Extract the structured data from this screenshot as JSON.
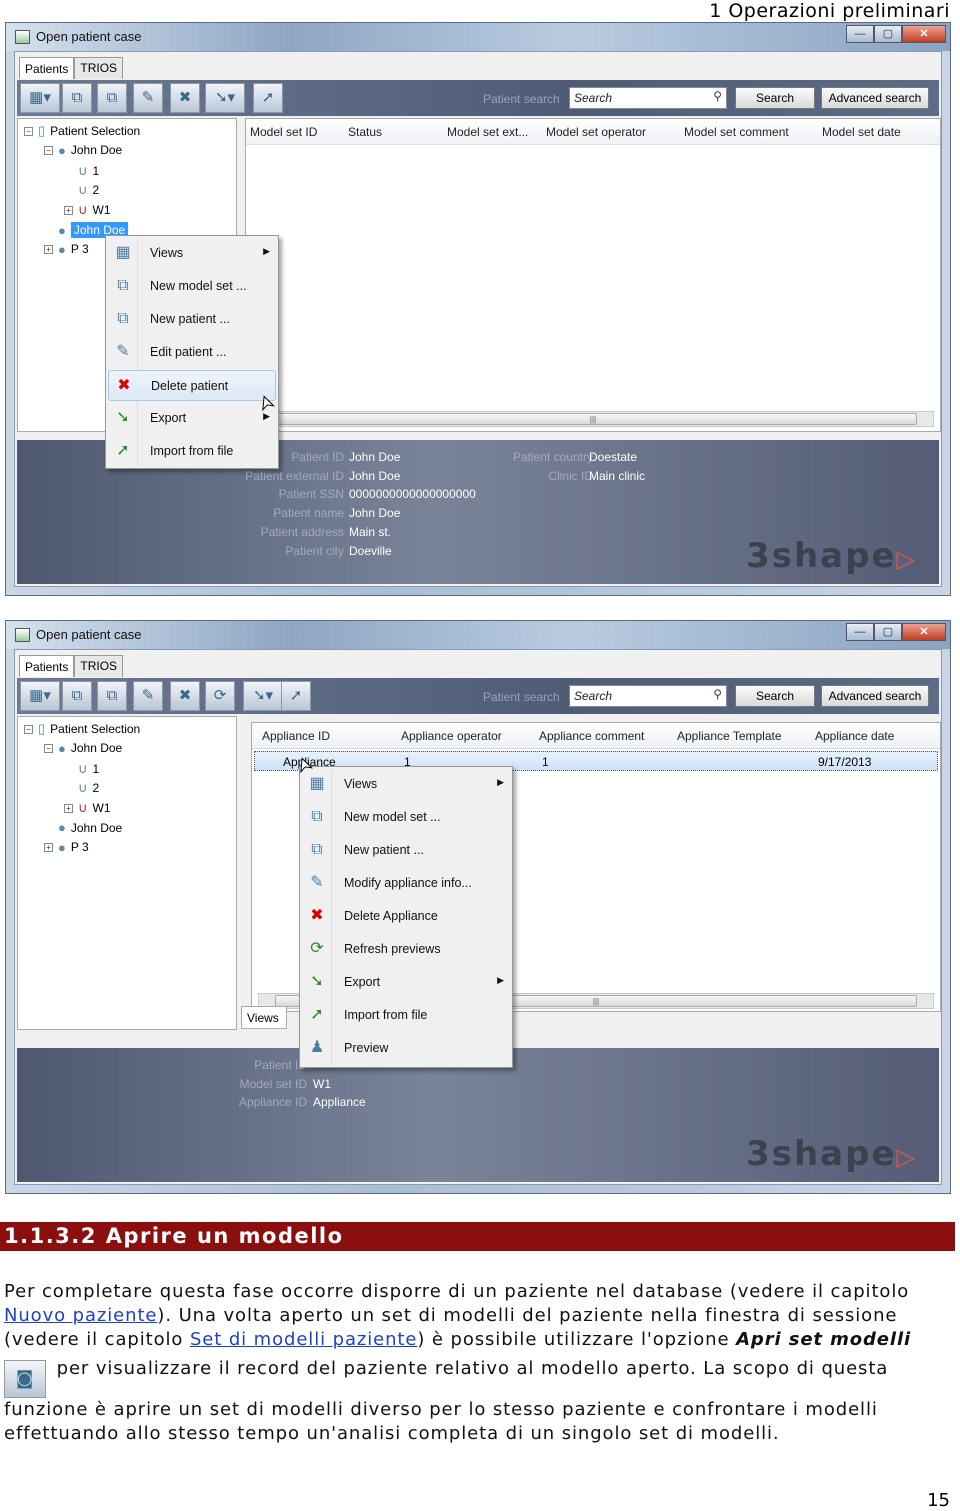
{
  "page_header": "1 Operazioni preliminari",
  "page_number": "15",
  "windows": [
    {
      "title": "Open patient case",
      "tabs": [
        "Patients",
        "TRIOS"
      ],
      "toolbar_icons": [
        "views-grid-icon",
        "new-model-set-icon",
        "new-patient-icon",
        "edit-patient-icon",
        "delete-patient-icon",
        "export-icon",
        "import-icon"
      ],
      "patient_search_label": "Patient search",
      "search_placeholder": "Search",
      "search_button": "Search",
      "advanced_search_button": "Advanced search",
      "tree": [
        {
          "label": "Patient Selection",
          "level": 0,
          "expander": "−",
          "icon": "folder-icon"
        },
        {
          "label": "John Doe",
          "level": 1,
          "expander": "−",
          "icon": "patient-icon"
        },
        {
          "label": "1",
          "level": 2,
          "icon": "appliance-icon"
        },
        {
          "label": "2",
          "level": 2,
          "icon": "appliance-icon"
        },
        {
          "label": "W1",
          "level": 2,
          "expander": "+",
          "icon": "appliance-alert-icon"
        },
        {
          "label": "John Doe",
          "level": 1,
          "icon": "patient-icon",
          "selected": true
        },
        {
          "label": "P 3",
          "level": 1,
          "expander": "+",
          "icon": "patient-icon"
        }
      ],
      "columns": [
        "Model set ID",
        "Status",
        "Model set ext...",
        "Model set operator",
        "Model set comment",
        "Model set date"
      ],
      "rows": [],
      "details_left": [
        [
          "Patient ID",
          "John Doe"
        ],
        [
          "Patient external ID",
          "John Doe"
        ],
        [
          "Patient SSN",
          "0000000000000000000"
        ],
        [
          "Patient name",
          "John Doe"
        ],
        [
          "Patient address",
          "Main st."
        ],
        [
          "Patient city",
          "Doeville"
        ]
      ],
      "details_right": [
        [
          "Patient country",
          "Doestate"
        ],
        [
          "Clinic ID",
          "Main clinic"
        ]
      ],
      "context_menu": [
        {
          "label": "Views",
          "icon": "views-grid-icon",
          "submenu": true
        },
        {
          "label": "New model set ...",
          "icon": "new-model-set-icon"
        },
        {
          "label": "New patient ...",
          "icon": "new-patient-icon"
        },
        {
          "label": "Edit patient ...",
          "icon": "edit-patient-icon"
        },
        {
          "label": "Delete patient",
          "icon": "delete-patient-icon",
          "highlighted": true
        },
        {
          "label": "Export",
          "icon": "export-icon",
          "submenu": true
        },
        {
          "label": "Import from file",
          "icon": "import-icon"
        }
      ],
      "logo": "3shape"
    },
    {
      "title": "Open patient case",
      "tabs": [
        "Patients",
        "TRIOS"
      ],
      "toolbar_icons": [
        "views-grid-icon",
        "new-model-set-icon",
        "new-patient-icon",
        "modify-appliance-icon",
        "delete-appliance-icon",
        "refresh-icon",
        "export-icon",
        "import-icon"
      ],
      "patient_search_label": "Patient search",
      "search_placeholder": "Search",
      "search_button": "Search",
      "advanced_search_button": "Advanced search",
      "tree": [
        {
          "label": "Patient Selection",
          "level": 0,
          "expander": "−",
          "icon": "folder-icon"
        },
        {
          "label": "John Doe",
          "level": 1,
          "expander": "−",
          "icon": "patient-icon"
        },
        {
          "label": "1",
          "level": 2,
          "icon": "appliance-icon"
        },
        {
          "label": "2",
          "level": 2,
          "icon": "appliance-icon"
        },
        {
          "label": "W1",
          "level": 2,
          "expander": "+",
          "icon": "appliance-alert-icon"
        },
        {
          "label": "John Doe",
          "level": 1,
          "icon": "patient-icon"
        },
        {
          "label": "P 3",
          "level": 1,
          "expander": "+",
          "icon": "patient-icon"
        }
      ],
      "columns": [
        "Appliance ID",
        "Appliance operator",
        "Appliance comment",
        "Appliance Template",
        "Appliance date"
      ],
      "rows": [
        [
          "Appliance",
          "1",
          "1",
          "",
          "9/17/2013"
        ]
      ],
      "views_tab": "Views",
      "details_left": [
        [
          "Patient ID",
          ""
        ],
        [
          "Model set ID",
          "W1"
        ],
        [
          "Appliance ID",
          "Appliance"
        ]
      ],
      "details_right": [],
      "context_menu": [
        {
          "label": "Views",
          "icon": "views-grid-icon",
          "submenu": true
        },
        {
          "label": "New model set ...",
          "icon": "new-model-set-icon"
        },
        {
          "label": "New patient ...",
          "icon": "new-patient-icon"
        },
        {
          "label": "Modify appliance info...",
          "icon": "modify-appliance-icon"
        },
        {
          "label": "Delete Appliance",
          "icon": "delete-appliance-icon"
        },
        {
          "label": "Refresh previews",
          "icon": "refresh-icon"
        },
        {
          "label": "Export",
          "icon": "export-icon",
          "submenu": true
        },
        {
          "label": "Import from file",
          "icon": "import-icon"
        },
        {
          "label": "Preview",
          "icon": "preview-icon"
        }
      ],
      "logo": "3shape"
    }
  ],
  "section": {
    "heading": "1.1.3.2 Aprire un modello",
    "p1": "Per completare questa fase occorre disporre di un paziente nel database (vedere il capitolo ",
    "link1": "Nuovo paziente",
    "p2": "). Una volta aperto un set di modelli del paziente nella finestra di sessione (vedere il capitolo ",
    "link2": "Set di modelli paziente",
    "p3": ") è possibile utilizzare l'opzione ",
    "option": "Apri set modelli",
    "icon": "open-model-set-icon",
    "p4": " per visualizzare il record del paziente relativo al modello aperto. La scopo di questa funzione è aprire un set di modelli diverso per lo stesso paziente e confrontare i modelli effettuando allo stesso tempo un'analisi completa di un singolo set di modelli."
  }
}
